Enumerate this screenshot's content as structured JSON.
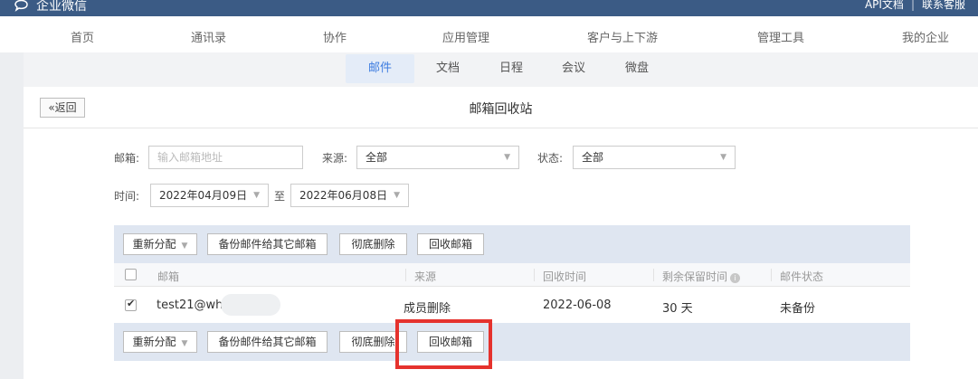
{
  "app": {
    "name": "企业微信"
  },
  "toplinks": {
    "api": "API文档",
    "sep": "|",
    "support": "联系客服"
  },
  "mainnav": [
    "首页",
    "通讯录",
    "协作",
    "应用管理",
    "客户与上下游",
    "管理工具",
    "我的企业"
  ],
  "subnav": [
    {
      "label": "邮件",
      "active": true
    },
    {
      "label": "文档",
      "active": false
    },
    {
      "label": "日程",
      "active": false
    },
    {
      "label": "会议",
      "active": false
    },
    {
      "label": "微盘",
      "active": false
    }
  ],
  "page": {
    "back": "«返回",
    "title": "邮箱回收站"
  },
  "filters": {
    "mailbox_label": "邮箱:",
    "mailbox_placeholder": "输入邮箱地址",
    "source_label": "来源:",
    "source_value": "全部",
    "status_label": "状态:",
    "status_value": "全部",
    "time_label": "时间:",
    "start_date": "2022年04月09日",
    "to": "至",
    "end_date": "2022年06月08日"
  },
  "toolbar": {
    "reassign": "重新分配",
    "backup": "备份邮件给其它邮箱",
    "delete": "彻底删除",
    "recover": "回收邮箱"
  },
  "columns": [
    "邮箱",
    "来源",
    "回收时间",
    "剩余保留时间",
    "邮件状态"
  ],
  "rows": [
    {
      "checked": true,
      "mailbox": "test21@wh",
      "source": "成员删除",
      "recycle_time": "2022-06-08",
      "retention": "30 天",
      "status": "未备份"
    }
  ],
  "colors": {
    "topbar": "#3b5b85",
    "accent": "#3e7de0",
    "toolbar": "#dfe6f1",
    "highlight": "#e5322d"
  }
}
